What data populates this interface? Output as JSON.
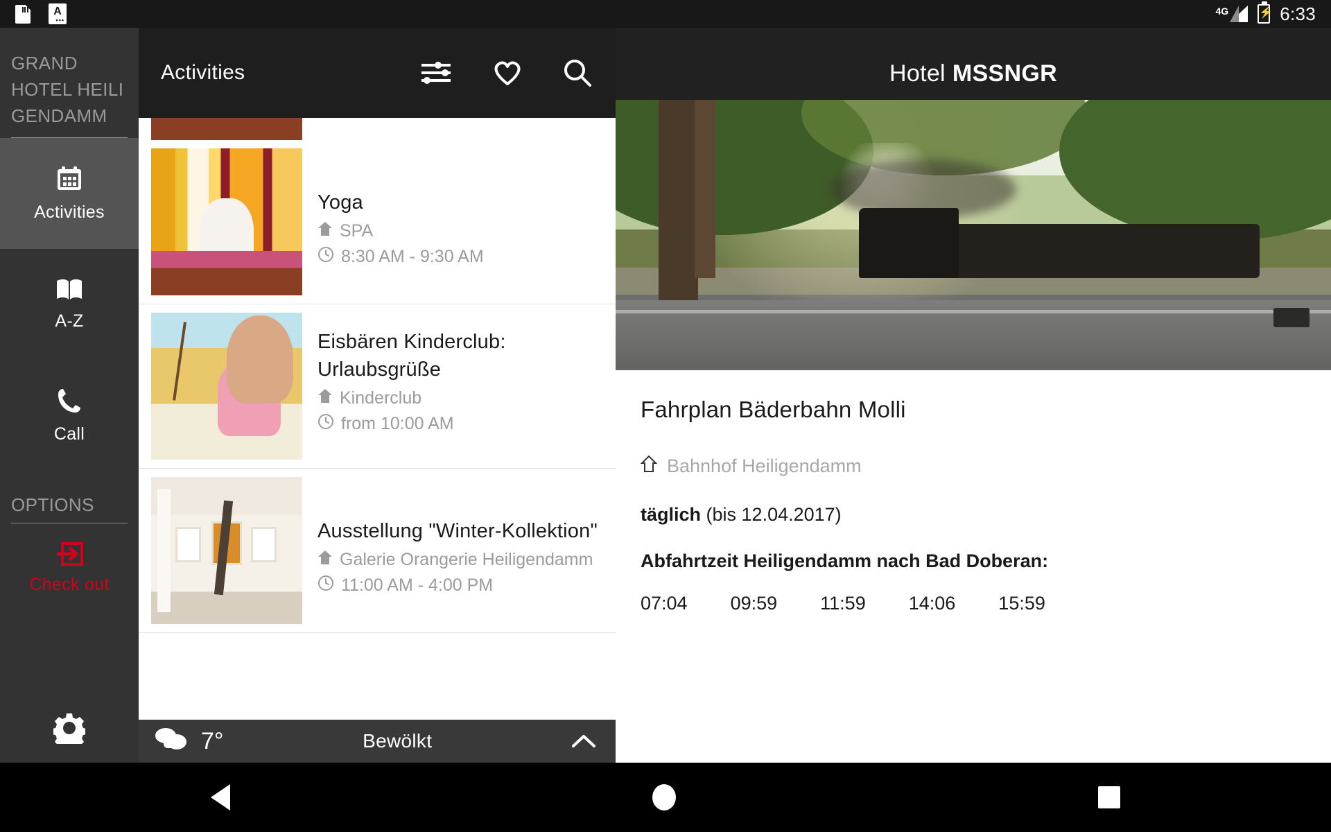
{
  "status_bar": {
    "icons": [
      "sdcard-icon",
      "app-badge-icon"
    ],
    "app_badge_letter": "A",
    "network": "4G",
    "clock": "6:33"
  },
  "drawer": {
    "hotel_name": "GRAND HOTEL HEILI GENDAMM",
    "hotel_name_lines": [
      "GRAND",
      "HOTEL HEILI",
      "GENDAMM"
    ],
    "items": [
      {
        "label": "Activities",
        "icon": "calendar-icon",
        "active": true
      },
      {
        "label": "A-Z",
        "icon": "book-icon",
        "active": false
      },
      {
        "label": "Call",
        "icon": "phone-icon",
        "active": false
      }
    ],
    "options_header": "OPTIONS",
    "checkout": {
      "label": "Check out",
      "icon": "logout-icon",
      "color": "#d0021b"
    },
    "settings_icon": "gear-icon"
  },
  "list_panel": {
    "title": "Activities",
    "icons": [
      "filter-icon",
      "heart-icon",
      "search-icon"
    ],
    "rows": [
      {
        "title": "Yoga",
        "location": "SPA",
        "time": "8:30 AM - 9:30 AM",
        "location_icon": "home-icon",
        "time_icon": "clock-icon",
        "thumb": "yoga-thumbnail"
      },
      {
        "title": "Eisbären Kinderclub: Urlaubsgrüße",
        "location": "Kinderclub",
        "time": "from 10:00 AM",
        "location_icon": "home-icon",
        "time_icon": "clock-icon",
        "thumb": "kinderclub-thumbnail"
      },
      {
        "title": "Ausstellung \"Winter-Kollektion\"",
        "location": "Galerie Orangerie Heiligendamm",
        "time": "11:00 AM - 4:00 PM",
        "location_icon": "home-icon",
        "time_icon": "clock-icon",
        "thumb": "gallery-thumbnail"
      }
    ]
  },
  "weather_bar": {
    "icon": "cloudy-icon",
    "temperature": "7°",
    "description": "Bewölkt",
    "expand_icon": "chevron-up-icon"
  },
  "detail_panel": {
    "app_title_light": "Hotel",
    "app_title_bold": "MSSNGR",
    "hero_image": "steam-train-alley-photo",
    "title": "Fahrplan Bäderbahn Molli",
    "location_icon": "home-outline-icon",
    "location": "Bahnhof Heiligendamm",
    "schedule_label": "täglich",
    "schedule_note": "(bis 12.04.2017)",
    "departure_heading": "Abfahrtzeit Heiligendamm nach Bad Doberan:",
    "departure_times": [
      "07:04",
      "09:59",
      "11:59",
      "14:06",
      "15:59"
    ]
  },
  "nav_bar": {
    "back": "back-triangle-icon",
    "home": "home-circle-icon",
    "recents": "recents-square-icon"
  },
  "colors": {
    "drawer_bg": "#333333",
    "drawer_active": "#545454",
    "panel_bg": "#212121",
    "header_bg": "#1e1e1e",
    "accent_red": "#d0021b",
    "muted_text": "#9b9b9b"
  }
}
